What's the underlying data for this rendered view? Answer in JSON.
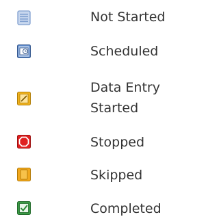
{
  "legend": {
    "items": [
      {
        "label": "Not Started",
        "icon": "not-started-icon",
        "color": "#9bb6de"
      },
      {
        "label": "Scheduled",
        "icon": "scheduled-icon",
        "color": "#5b86c6"
      },
      {
        "label_lines": [
          "Data Entry",
          "Started"
        ],
        "icon": "data-entry-started-icon",
        "color": "#f0b21d"
      },
      {
        "label": "Stopped",
        "icon": "stopped-icon",
        "color": "#e02020"
      },
      {
        "label": "Skipped",
        "icon": "skipped-icon",
        "color": "#f2a81c"
      },
      {
        "label": "Completed",
        "icon": "completed-icon",
        "color": "#3a9a45"
      }
    ]
  }
}
